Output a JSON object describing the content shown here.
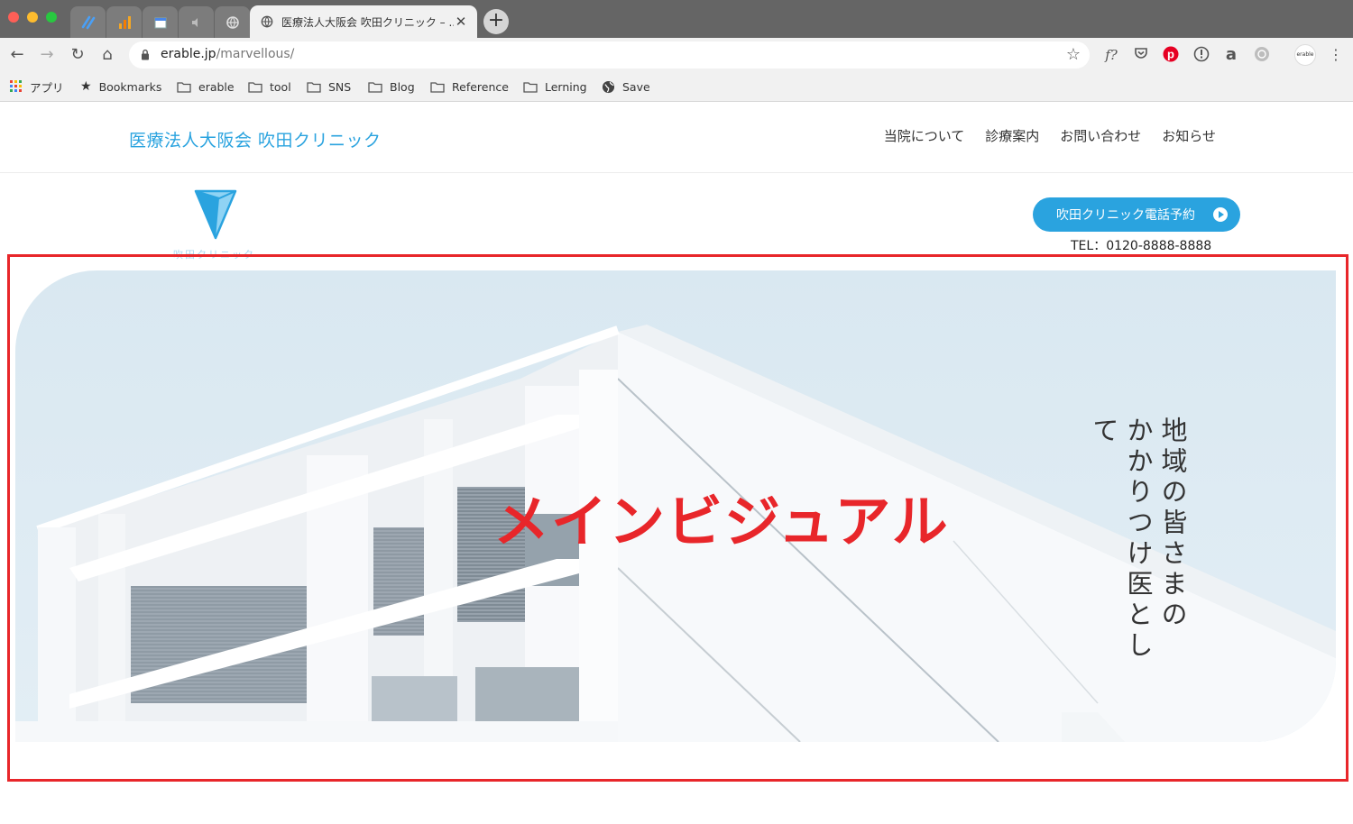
{
  "browser": {
    "active_tab_title": "医療法人大阪会 吹田クリニック – ...",
    "url_host": "erable.jp",
    "url_path": "/marvellous/",
    "bookmarks": [
      "アプリ",
      "Bookmarks",
      "erable",
      "tool",
      "SNS",
      "Blog",
      "Reference",
      "Lerning",
      "Save"
    ],
    "extension_labels": [
      "f?",
      "a",
      "erable"
    ]
  },
  "site": {
    "title": "医療法人大阪会 吹田クリニック",
    "nav": [
      "当院について",
      "診療案内",
      "お問い合わせ",
      "お知らせ"
    ],
    "logo_subtitle": "吹田クリニック",
    "call_button": "吹田クリニック電話予約",
    "tel": "TEL：0120-8888-8888"
  },
  "hero": {
    "label": "メインビジュアル",
    "catchcopy_line1": "地域の皆さまの",
    "catchcopy_line2": "かかりつけ医として"
  },
  "colors": {
    "accent": "#2aa3df",
    "annotation_red": "#e8262a",
    "sky": "#dbe9f2"
  },
  "icons": [
    "back-icon",
    "forward-icon",
    "reload-icon",
    "home-icon",
    "lock-icon",
    "star-icon",
    "apps-grid-icon",
    "folder-icon",
    "globe-icon",
    "play-circle-icon"
  ]
}
